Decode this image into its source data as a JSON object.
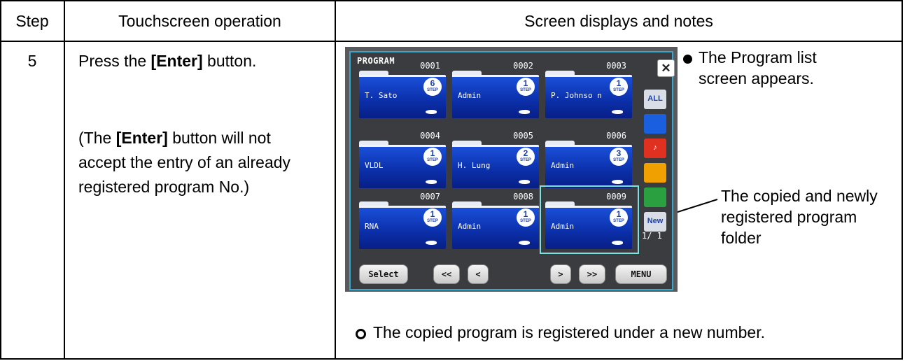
{
  "table": {
    "headers": {
      "step": "Step",
      "operation": "Touchscreen operation",
      "notes": "Screen displays and notes"
    },
    "row": {
      "step_number": "5",
      "instruction_pre": "Press the ",
      "instruction_bold": "[Enter]",
      "instruction_post": " button.",
      "note_open": "(The ",
      "note_bold": "[Enter]",
      "note_line1_post": " button will not",
      "note_line2": "accept the entry of an already",
      "note_line3": "registered program No.)",
      "bullet1_line1": "The Program list",
      "bullet1_line2": "screen appears.",
      "callout_line1": "The copied and newly",
      "callout_line2": "registered program",
      "callout_line3": "folder",
      "footer_note": "The copied program is registered under a new number."
    }
  },
  "screen": {
    "title": "PROGRAM",
    "close_label": "✕",
    "step_label": "STEP",
    "folders": [
      {
        "number": "0001",
        "owner": "T. Sato",
        "steps": "6"
      },
      {
        "number": "0002",
        "owner": "Admin",
        "steps": "1"
      },
      {
        "number": "0003",
        "owner": "P. Johnso n",
        "steps": "1"
      },
      {
        "number": "0004",
        "owner": "VLDL",
        "steps": "1"
      },
      {
        "number": "0005",
        "owner": "H. Lung",
        "steps": "2"
      },
      {
        "number": "0006",
        "owner": "Admin",
        "steps": "3"
      },
      {
        "number": "0007",
        "owner": "RNA",
        "steps": "1"
      },
      {
        "number": "0008",
        "owner": "Admin",
        "steps": "1"
      },
      {
        "number": "0009",
        "owner": "Admin",
        "steps": "1"
      }
    ],
    "side_buttons": [
      {
        "label": "ALL",
        "color": "#d9dde6"
      },
      {
        "label": "",
        "color": "#1a5fe0"
      },
      {
        "label": "♪",
        "color": "#e03020"
      },
      {
        "label": "",
        "color": "#f0a000"
      },
      {
        "label": "",
        "color": "#2aa040"
      },
      {
        "label": "New",
        "color": "#d9dde6"
      }
    ],
    "page_indicator": "1/ 1",
    "nav": {
      "select": "Select",
      "first": "<<",
      "prev": "<",
      "next": ">",
      "last": ">>",
      "menu": "MENU"
    }
  }
}
